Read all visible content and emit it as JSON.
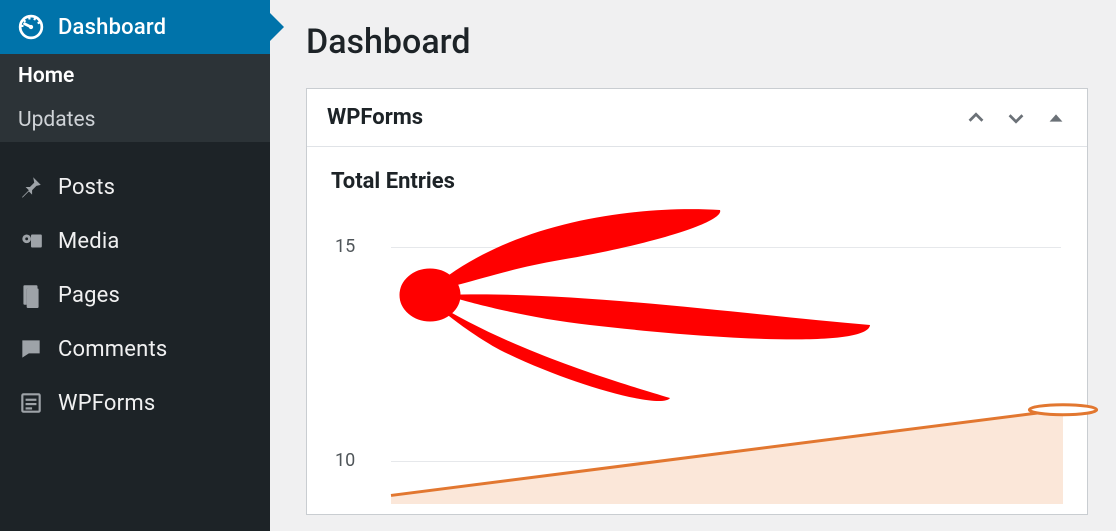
{
  "sidebar": {
    "dashboard_label": "Dashboard",
    "submenu": {
      "home": "Home",
      "updates": "Updates"
    },
    "items": [
      {
        "icon": "pin",
        "label": "Posts"
      },
      {
        "icon": "media",
        "label": "Media"
      },
      {
        "icon": "pages",
        "label": "Pages"
      },
      {
        "icon": "comment",
        "label": "Comments"
      },
      {
        "icon": "wpforms",
        "label": "WPForms"
      }
    ]
  },
  "page": {
    "title": "Dashboard"
  },
  "widget": {
    "title": "WPForms",
    "section_title": "Total Entries"
  },
  "chart_data": {
    "type": "line",
    "title": "Total Entries",
    "xlabel": "",
    "ylabel": "",
    "ylim": [
      9,
      16
    ],
    "yticks": [
      10,
      15
    ],
    "x": [
      0,
      1
    ],
    "values": [
      9.2,
      11.2
    ]
  },
  "colors": {
    "accent": "#0073aa",
    "sidebar_bg": "#1d2327",
    "chart_line": "#e27730",
    "chart_fill": "#fbe7d9",
    "annotation": "#ff0000"
  }
}
